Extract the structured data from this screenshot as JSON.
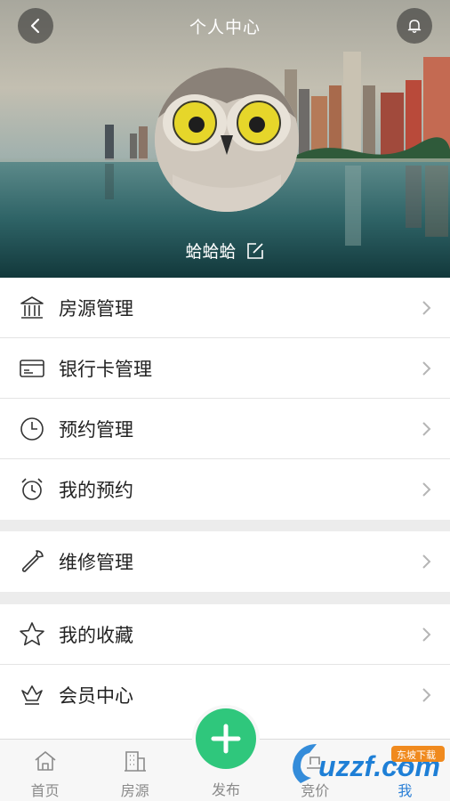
{
  "header": {
    "title": "个人中心",
    "username": "蛤蛤蛤"
  },
  "menu_groups": [
    {
      "items": [
        {
          "label": "房源管理",
          "icon": "building-icon"
        },
        {
          "label": "银行卡管理",
          "icon": "bank-card-icon"
        },
        {
          "label": "预约管理",
          "icon": "clock-icon"
        },
        {
          "label": "我的预约",
          "icon": "alarm-clock-icon"
        }
      ]
    },
    {
      "items": [
        {
          "label": "维修管理",
          "icon": "wrench-icon"
        }
      ]
    },
    {
      "items": [
        {
          "label": "我的收藏",
          "icon": "star-icon"
        },
        {
          "label": "会员中心",
          "icon": "crown-icon"
        }
      ]
    }
  ],
  "tabbar": {
    "tabs": [
      {
        "label": "首页",
        "icon": "home-icon"
      },
      {
        "label": "房源",
        "icon": "building-icon"
      },
      {
        "label": "发布",
        "icon": "plus-icon"
      },
      {
        "label": "竞价",
        "icon": "bid-icon"
      },
      {
        "label": "我",
        "icon": "user-icon"
      }
    ],
    "active": "我"
  },
  "watermark": {
    "brand": "uzzf.com",
    "badge": "东坡下载"
  },
  "colors": {
    "accent": "#2fc77c",
    "active_tab": "#2b7fd6"
  }
}
